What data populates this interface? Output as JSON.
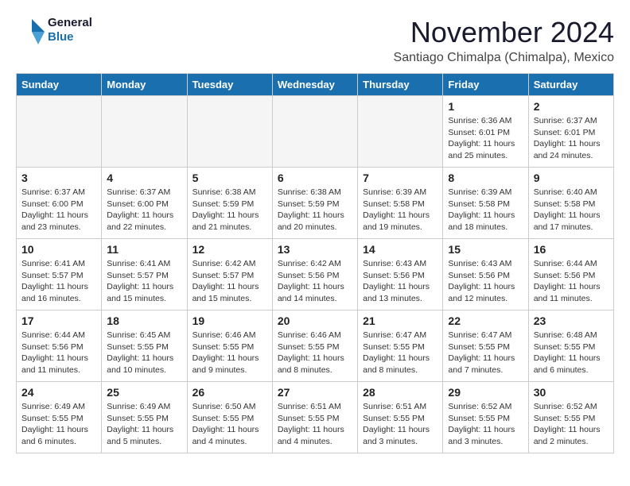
{
  "logo": {
    "line1": "General",
    "line2": "Blue"
  },
  "title": "November 2024",
  "subtitle": "Santiago Chimalpa (Chimalpa), Mexico",
  "headers": [
    "Sunday",
    "Monday",
    "Tuesday",
    "Wednesday",
    "Thursday",
    "Friday",
    "Saturday"
  ],
  "weeks": [
    [
      {
        "day": "",
        "text": ""
      },
      {
        "day": "",
        "text": ""
      },
      {
        "day": "",
        "text": ""
      },
      {
        "day": "",
        "text": ""
      },
      {
        "day": "",
        "text": ""
      },
      {
        "day": "1",
        "text": "Sunrise: 6:36 AM\nSunset: 6:01 PM\nDaylight: 11 hours and 25 minutes."
      },
      {
        "day": "2",
        "text": "Sunrise: 6:37 AM\nSunset: 6:01 PM\nDaylight: 11 hours and 24 minutes."
      }
    ],
    [
      {
        "day": "3",
        "text": "Sunrise: 6:37 AM\nSunset: 6:00 PM\nDaylight: 11 hours and 23 minutes."
      },
      {
        "day": "4",
        "text": "Sunrise: 6:37 AM\nSunset: 6:00 PM\nDaylight: 11 hours and 22 minutes."
      },
      {
        "day": "5",
        "text": "Sunrise: 6:38 AM\nSunset: 5:59 PM\nDaylight: 11 hours and 21 minutes."
      },
      {
        "day": "6",
        "text": "Sunrise: 6:38 AM\nSunset: 5:59 PM\nDaylight: 11 hours and 20 minutes."
      },
      {
        "day": "7",
        "text": "Sunrise: 6:39 AM\nSunset: 5:58 PM\nDaylight: 11 hours and 19 minutes."
      },
      {
        "day": "8",
        "text": "Sunrise: 6:39 AM\nSunset: 5:58 PM\nDaylight: 11 hours and 18 minutes."
      },
      {
        "day": "9",
        "text": "Sunrise: 6:40 AM\nSunset: 5:58 PM\nDaylight: 11 hours and 17 minutes."
      }
    ],
    [
      {
        "day": "10",
        "text": "Sunrise: 6:41 AM\nSunset: 5:57 PM\nDaylight: 11 hours and 16 minutes."
      },
      {
        "day": "11",
        "text": "Sunrise: 6:41 AM\nSunset: 5:57 PM\nDaylight: 11 hours and 15 minutes."
      },
      {
        "day": "12",
        "text": "Sunrise: 6:42 AM\nSunset: 5:57 PM\nDaylight: 11 hours and 15 minutes."
      },
      {
        "day": "13",
        "text": "Sunrise: 6:42 AM\nSunset: 5:56 PM\nDaylight: 11 hours and 14 minutes."
      },
      {
        "day": "14",
        "text": "Sunrise: 6:43 AM\nSunset: 5:56 PM\nDaylight: 11 hours and 13 minutes."
      },
      {
        "day": "15",
        "text": "Sunrise: 6:43 AM\nSunset: 5:56 PM\nDaylight: 11 hours and 12 minutes."
      },
      {
        "day": "16",
        "text": "Sunrise: 6:44 AM\nSunset: 5:56 PM\nDaylight: 11 hours and 11 minutes."
      }
    ],
    [
      {
        "day": "17",
        "text": "Sunrise: 6:44 AM\nSunset: 5:56 PM\nDaylight: 11 hours and 11 minutes."
      },
      {
        "day": "18",
        "text": "Sunrise: 6:45 AM\nSunset: 5:55 PM\nDaylight: 11 hours and 10 minutes."
      },
      {
        "day": "19",
        "text": "Sunrise: 6:46 AM\nSunset: 5:55 PM\nDaylight: 11 hours and 9 minutes."
      },
      {
        "day": "20",
        "text": "Sunrise: 6:46 AM\nSunset: 5:55 PM\nDaylight: 11 hours and 8 minutes."
      },
      {
        "day": "21",
        "text": "Sunrise: 6:47 AM\nSunset: 5:55 PM\nDaylight: 11 hours and 8 minutes."
      },
      {
        "day": "22",
        "text": "Sunrise: 6:47 AM\nSunset: 5:55 PM\nDaylight: 11 hours and 7 minutes."
      },
      {
        "day": "23",
        "text": "Sunrise: 6:48 AM\nSunset: 5:55 PM\nDaylight: 11 hours and 6 minutes."
      }
    ],
    [
      {
        "day": "24",
        "text": "Sunrise: 6:49 AM\nSunset: 5:55 PM\nDaylight: 11 hours and 6 minutes."
      },
      {
        "day": "25",
        "text": "Sunrise: 6:49 AM\nSunset: 5:55 PM\nDaylight: 11 hours and 5 minutes."
      },
      {
        "day": "26",
        "text": "Sunrise: 6:50 AM\nSunset: 5:55 PM\nDaylight: 11 hours and 4 minutes."
      },
      {
        "day": "27",
        "text": "Sunrise: 6:51 AM\nSunset: 5:55 PM\nDaylight: 11 hours and 4 minutes."
      },
      {
        "day": "28",
        "text": "Sunrise: 6:51 AM\nSunset: 5:55 PM\nDaylight: 11 hours and 3 minutes."
      },
      {
        "day": "29",
        "text": "Sunrise: 6:52 AM\nSunset: 5:55 PM\nDaylight: 11 hours and 3 minutes."
      },
      {
        "day": "30",
        "text": "Sunrise: 6:52 AM\nSunset: 5:55 PM\nDaylight: 11 hours and 2 minutes."
      }
    ]
  ]
}
